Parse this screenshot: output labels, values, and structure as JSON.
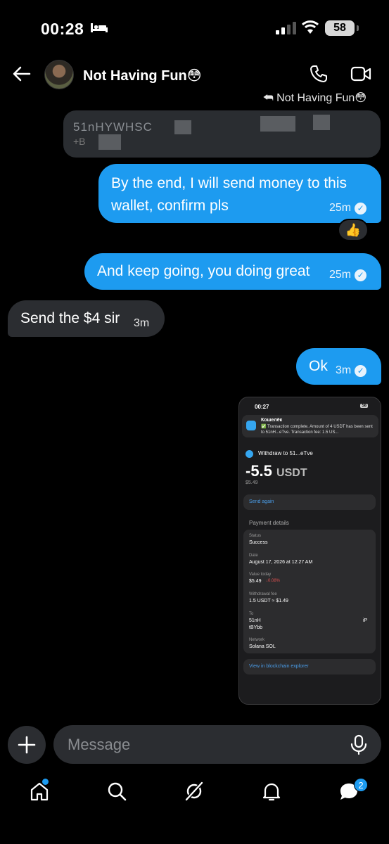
{
  "status_bar": {
    "time": "00:28",
    "battery": "58"
  },
  "header": {
    "contact_name": "Not Having Fun😳"
  },
  "reply_ref": "⮪ Not Having Fun😳",
  "quoted_message": {
    "line1": "51nHYWHSC",
    "line2": "+B"
  },
  "messages": [
    {
      "text": "By the end, I will send money to this wallet, confirm pls",
      "time": "25m",
      "reaction": "👍"
    },
    {
      "text": "And keep going, you doing great",
      "time": "25m"
    },
    {
      "text": "Send the $4 sir",
      "time": "3m"
    },
    {
      "text": "Ok",
      "time": "3m"
    }
  ],
  "attachment": {
    "time": "00:27",
    "battery": "58",
    "notif_title": "Кошелёк",
    "notif_body": "✅ Transaction complete. Amount of 4 USDT has been sent to 51nH...eTve. Transaction fee: 1.5 US...",
    "withdraw_label": "Withdraw to 51...eTve",
    "amount": "-5.5",
    "amount_unit": "USDT",
    "usd_value": "$5.49",
    "send_again": "Send again",
    "payment_details_title": "Payment details",
    "status_label": "Status",
    "status_value": "Success",
    "date_label": "Date",
    "date_value": "August 17, 2026 at 12:27 AM",
    "value_label": "Value today",
    "value_value": "$5.49",
    "value_change": "↓0.08%",
    "fee_label": "Withdrawal fee",
    "fee_value": "1.5 USDT ≈ $1.49",
    "to_label": "To",
    "to_value1": "51nH",
    "to_value1_end": "iP",
    "to_value2": "tBYbb",
    "network_label": "Network",
    "network_value": "Solana SOL",
    "explorer": "View in blockchain explorer"
  },
  "composer": {
    "placeholder": "Message"
  },
  "tabbar": {
    "messages_badge": "2"
  },
  "icons": [
    "back-icon",
    "phone-icon",
    "video-icon",
    "plus-icon",
    "mic-icon",
    "home-icon",
    "search-icon",
    "grok-icon",
    "bell-icon",
    "messages-icon"
  ],
  "colors": {
    "accent": "#1d9bf0",
    "incoming_bubble": "#2b2d31",
    "background": "#000000"
  }
}
